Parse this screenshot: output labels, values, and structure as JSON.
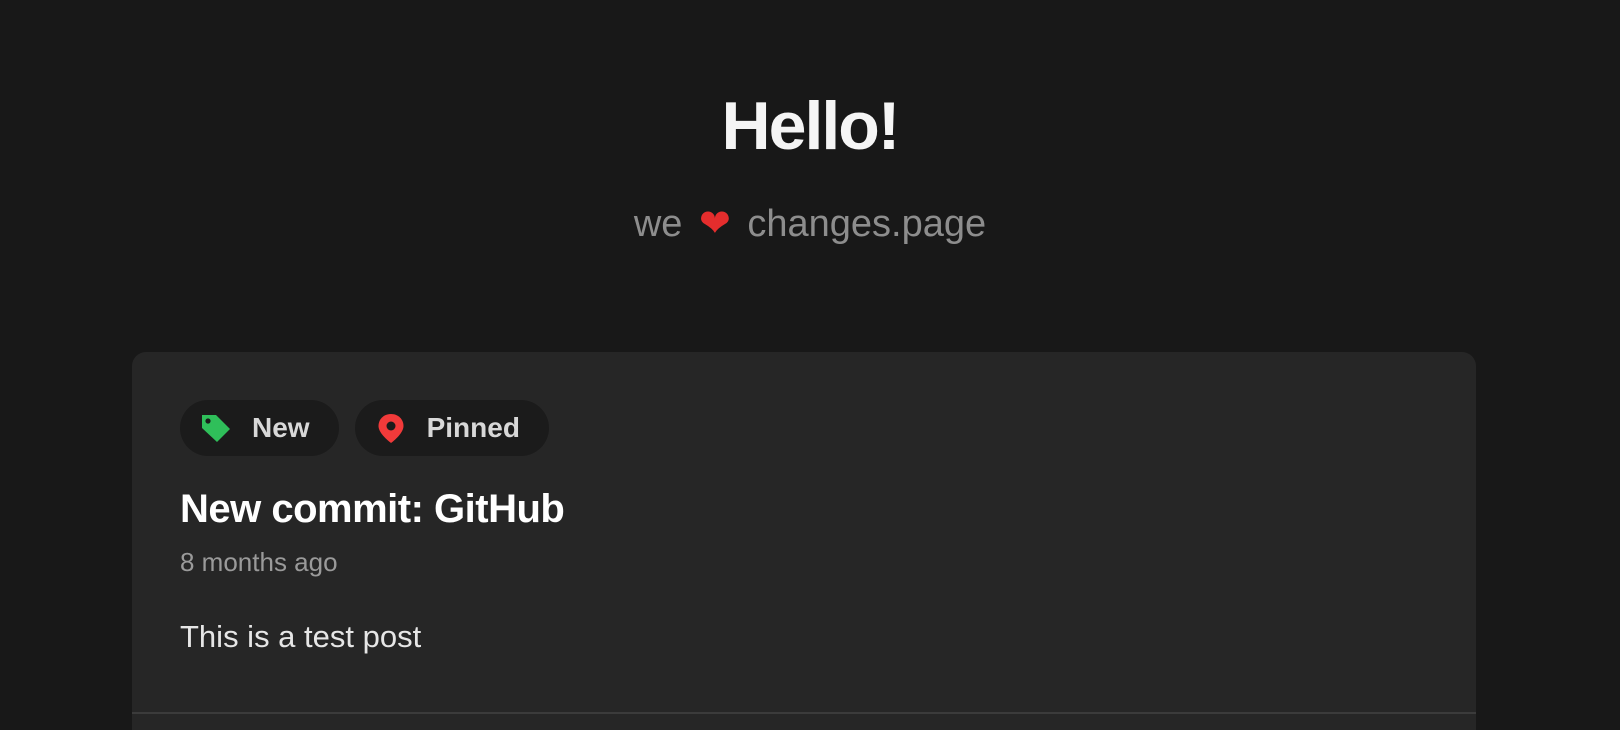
{
  "hero": {
    "title": "Hello!",
    "subtitle_prefix": "we",
    "heart": "❤",
    "subtitle_suffix": "changes.page"
  },
  "post": {
    "tags": [
      {
        "label": "New",
        "icon": "tag-icon",
        "color": "#2fbf5a"
      },
      {
        "label": "Pinned",
        "icon": "map-pin-icon",
        "color": "#f23a3a"
      }
    ],
    "title": "New commit: GitHub",
    "date": "8 months ago",
    "body": "This is a test post"
  }
}
